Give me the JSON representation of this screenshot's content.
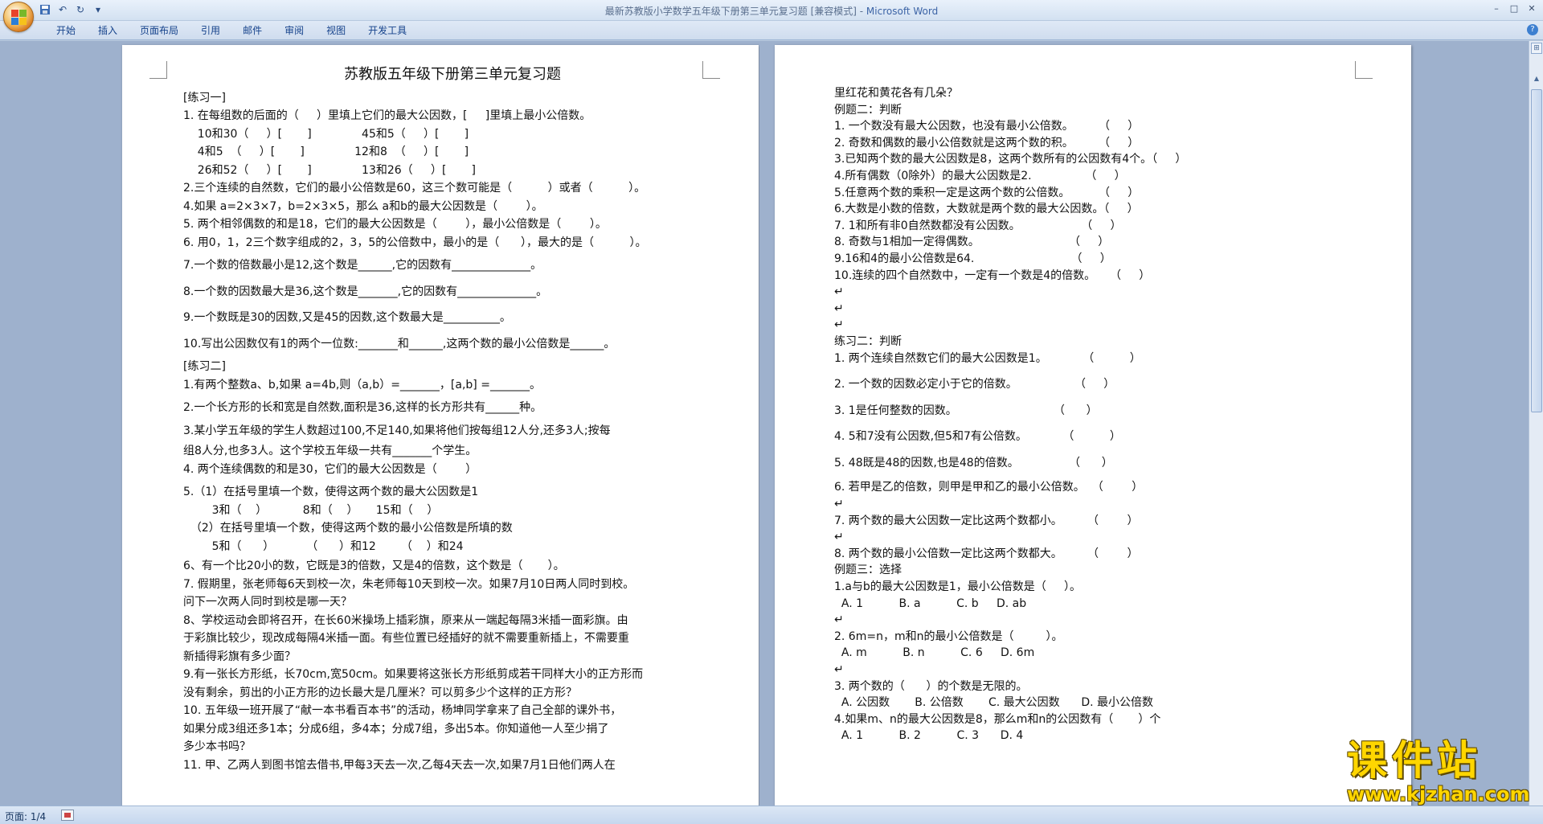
{
  "window": {
    "title": "最新苏教版小学数学五年级下册第三单元复习题 [兼容模式] - ",
    "app_name": "Microsoft Word",
    "controls": [
      "–",
      "□",
      "✕"
    ]
  },
  "ribbon": {
    "tabs": [
      "开始",
      "插入",
      "页面布局",
      "引用",
      "邮件",
      "审阅",
      "视图",
      "开发工具"
    ]
  },
  "page1": {
    "title": "苏教版五年级下册第三单元复习题",
    "lines": [
      "[练习一]",
      "1. 在每组数的后面的（     ）里填上它们的最大公因数，[     ]里填上最小公倍数。",
      "    10和30（     ）[       ]              45和5（     ）[       ]",
      "    4和5  （     ）[       ]              12和8  （     ）[       ]",
      "    26和52（     ）[       ]              13和26（     ）[       ]",
      "2.三个连续的自然数，它们的最小公倍数是60，这三个数可能是（          ）或者（          ）。",
      "4.如果 a=2×3×7，b=2×3×5，那么 a和b的最大公因数是（        ）。",
      "5. 两个相邻偶数的和是18，它们的最大公因数是（        ），最小公倍数是（        ）。",
      "6. 用0，1，2三个数字组成的2，3，5的公倍数中，最小的是（      ），最大的是（          ）。",
      "7.一个数的倍数最小是12,这个数是______,它的因数有______________。",
      "8.一个数的因数最大是36,这个数是_______,它的因数有______________。",
      "9.一个数既是30的因数,又是45的因数,这个数最大是__________。",
      "10.写出公因数仅有1的两个一位数:_______和______,这两个数的最小公倍数是______。",
      "[练习二]",
      "1.有两个整数a、b,如果 a=4b,则（a,b）=_______，[a,b] =_______。",
      "2.一个长方形的长和宽是自然数,面积是36,这样的长方形共有______种。",
      "3.某小学五年级的学生人数超过100,不足140,如果将他们按每组12人分,还多3人;按每",
      "组8人分,也多3人。这个学校五年级一共有_______个学生。",
      "4. 两个连续偶数的和是30，它们的最大公因数是（        ）",
      "5.（1）在括号里填一个数，使得这两个数的最大公因数是1",
      "        3和（    ）          8和（    ）     15和（    ）",
      "  （2）在括号里填一个数，使得这两个数的最小公倍数是所填的数",
      "        5和（      ）         （      ）和12       （    ）和24",
      "6、有一个比20小的数，它既是3的倍数，又是4的倍数，这个数是（       ）。",
      "7. 假期里，张老师每6天到校一次，朱老师每10天到校一次。如果7月10日两人同时到校。",
      "问下一次两人同时到校是哪一天？",
      "8、学校运动会即将召开，在长60米操场上插彩旗，原来从一端起每隔3米插一面彩旗。由",
      "于彩旗比较少，现改成每隔4米插一面。有些位置已经插好的就不需要重新插上，不需要重",
      "新插得彩旗有多少面？",
      "9.有一张长方形纸，长70cm,宽50cm。如果要将这张长方形纸剪成若干同样大小的正方形而",
      "没有剩余，剪出的小正方形的边长最大是几厘米？可以剪多少个这样的正方形？",
      "10. 五年级一班开展了“献一本书看百本书”的活动，杨坤同学拿来了自己全部的课外书，",
      "如果分成3组还多1本；分成6组，多4本；分成7组，多出5本。你知道他一人至少捐了",
      "多少本书吗？",
      "11. 甲、乙两人到图书馆去借书,甲每3天去一次,乙每4天去一次,如果7月1日他们两人在"
    ]
  },
  "page2": {
    "lines": [
      "里红花和黄花各有几朵？",
      "例题二：判断",
      "1. 一个数没有最大公因数，也没有最小公倍数。       （     ）",
      "2. 奇数和偶数的最小公倍数就是这两个数的积。       （     ）",
      "3.已知两个数的最大公因数是8，这两个数所有的公因数有4个。（     ）",
      "4.所有偶数（0除外）的最大公因数是2.               （     ）",
      "5.任意两个数的乘积一定是这两个数的公倍数。        （     ）",
      "6.大数是小数的倍数，大数就是两个数的最大公因数。（     ）",
      "7. 1和所有非0自然数都没有公因数。                 （     ）",
      "8. 奇数与1相加一定得偶数。                         （     ）",
      "9.16和4的最小公倍数是64.                           （     ）",
      "10.连续的四个自然数中，一定有一个数是4的倍数。    （     ）",
      "",
      "",
      "",
      "练习二：判断",
      "1. 两个连续自然数它们的最大公因数是1。          （          ）",
      "2. 一个数的因数必定小于它的倍数。                （     ）",
      "3. 1是任何整数的因数。                           （      ）",
      "4. 5和7没有公因数,但5和7有公倍数。          （          ）",
      "5. 48既是48的因数,也是48的倍数。              （      ）",
      "6. 若甲是乙的倍数，则甲是甲和乙的最小公倍数。  （        ）",
      "",
      "7. 两个数的最大公因数一定比这两个数都小。       （        ）",
      "",
      "8. 两个数的最小公倍数一定比这两个数都大。       （        ）",
      "例题三：选择",
      "1.a与b的最大公因数是1，最小公倍数是（     ）。",
      "  A. 1          B. a          C. b     D. ab",
      "",
      "2. 6m=n，m和n的最小公倍数是（         ）。",
      "  A. m          B. n          C. 6     D. 6m",
      "",
      "3. 两个数的（      ）的个数是无限的。",
      "  A. 公因数       B. 公倍数       C. 最大公因数      D. 最小公倍数",
      "4.如果m、n的最大公因数是8，那么m和n的公因数有（       ）个",
      "  A. 1          B. 2          C. 3      D. 4"
    ]
  },
  "statusbar": {
    "page_info": "页面: 1/4"
  },
  "watermark": {
    "text": "课件站",
    "url": "www.kjzhan.com"
  }
}
